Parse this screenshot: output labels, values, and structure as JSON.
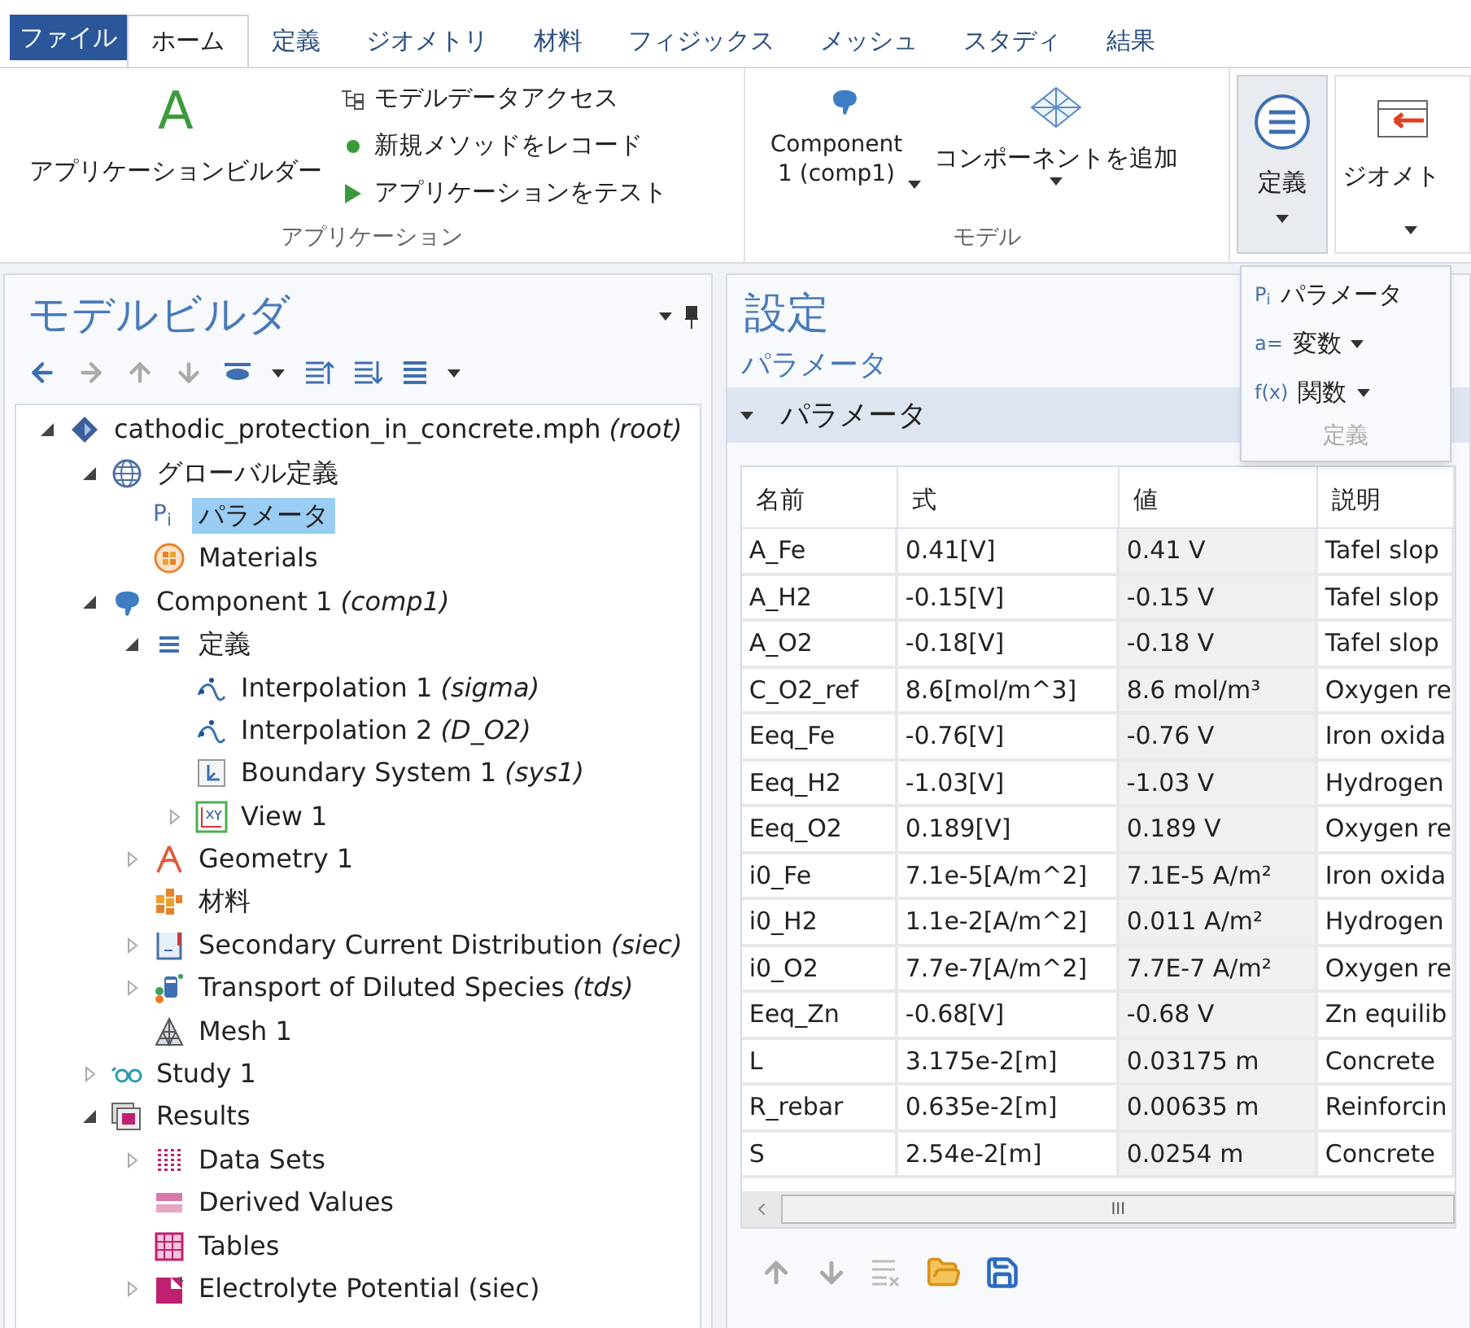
{
  "file_menu": {
    "label": "ファイル"
  },
  "tabs": [
    {
      "label": "ホーム",
      "selected": true
    },
    {
      "label": "定義",
      "selected": false
    },
    {
      "label": "ジオメトリ",
      "selected": false
    },
    {
      "label": "材料",
      "selected": false
    },
    {
      "label": "フィジックス",
      "selected": false
    },
    {
      "label": "メッシュ",
      "selected": false
    },
    {
      "label": "スタディ",
      "selected": false
    },
    {
      "label": "結果",
      "selected": false
    }
  ],
  "ribbon": {
    "application": {
      "label": "アプリケーション",
      "big_button": {
        "icon_text": "A",
        "label": "アプリケーションビルダー"
      },
      "small_buttons": [
        {
          "kind": "data-access",
          "label": "モデルデータアクセス"
        },
        {
          "kind": "record",
          "label": "新規メソッドをレコード"
        },
        {
          "kind": "test",
          "label": "アプリケーションをテスト"
        }
      ]
    },
    "model": {
      "label": "モデル",
      "component": "Component 1 (comp1)",
      "add_component": "コンポーネントを追加"
    },
    "definitions_button": {
      "label": "定義",
      "pressed": true
    },
    "geometry_button": {
      "label": "ジオメト",
      "pressed": false
    }
  },
  "definitions_menu": {
    "items": [
      {
        "icon_text": "P$_{i}$",
        "label": "パラメータ",
        "has_submenu": false
      },
      {
        "icon_text": "a=",
        "label": "変数",
        "has_submenu": true
      },
      {
        "icon_text": "f(x)",
        "label": "関数",
        "has_submenu": true
      }
    ],
    "footer": "定義"
  },
  "model_builder": {
    "title": "モデルビルダ",
    "tree": [
      {
        "kind": "file",
        "label": "cathodic_protection_in_concrete.mph *(root)*",
        "expandable": true,
        "expanded": true,
        "selected": false,
        "children": [
          {
            "kind": "globe",
            "label": "グローバル定義",
            "expandable": true,
            "expanded": true,
            "selected": false,
            "children": [
              {
                "kind": "parameters",
                "icon_text": "P$_{i}$",
                "label": "パラメータ",
                "expandable": false,
                "expanded": false,
                "selected": true
              },
              {
                "kind": "materials",
                "label": "Materials",
                "expandable": false,
                "expanded": false,
                "selected": false
              }
            ]
          },
          {
            "kind": "component",
            "label": "Component 1 *(comp1)*",
            "expandable": true,
            "expanded": true,
            "selected": false,
            "children": [
              {
                "kind": "definitions",
                "label": "定義",
                "expandable": true,
                "expanded": true,
                "selected": false,
                "children": [
                  {
                    "kind": "interpolation",
                    "label": "Interpolation 1 *(sigma)*",
                    "expandable": false,
                    "expanded": false,
                    "selected": false
                  },
                  {
                    "kind": "interpolation",
                    "label": "Interpolation 2 *(D_O2)*",
                    "expandable": false,
                    "expanded": false,
                    "selected": false
                  },
                  {
                    "kind": "boundary-system",
                    "label": "Boundary System 1 *(sys1)*",
                    "expandable": false,
                    "expanded": false,
                    "selected": false
                  },
                  {
                    "kind": "view",
                    "label": "View 1",
                    "expandable": true,
                    "expanded": false,
                    "selected": false
                  }
                ]
              },
              {
                "kind": "geometry",
                "label": "Geometry 1",
                "expandable": true,
                "expanded": false,
                "selected": false
              },
              {
                "kind": "material",
                "label": "材料",
                "expandable": false,
                "expanded": false,
                "selected": false
              },
              {
                "kind": "current",
                "label": "Secondary Current Distribution *(siec)*",
                "expandable": true,
                "expanded": false,
                "selected": false
              },
              {
                "kind": "transport",
                "label": "Transport of Diluted Species *(tds)*",
                "expandable": true,
                "expanded": false,
                "selected": false
              },
              {
                "kind": "mesh",
                "label": "Mesh 1",
                "expandable": false,
                "expanded": false,
                "selected": false
              }
            ]
          },
          {
            "kind": "study",
            "label": "Study 1",
            "expandable": true,
            "expanded": false,
            "selected": false
          },
          {
            "kind": "results",
            "label": "Results",
            "expandable": true,
            "expanded": true,
            "selected": false,
            "children": [
              {
                "kind": "datasets",
                "label": "Data Sets",
                "expandable": true,
                "expanded": false,
                "selected": false
              },
              {
                "kind": "derived",
                "label": "Derived Values",
                "expandable": false,
                "expanded": false,
                "selected": false
              },
              {
                "kind": "tables",
                "label": "Tables",
                "expandable": false,
                "expanded": false,
                "selected": false
              },
              {
                "kind": "plot",
                "label": "Electrolyte Potential (siec)",
                "expandable": true,
                "expanded": false,
                "selected": false
              }
            ]
          }
        ]
      }
    ]
  },
  "settings": {
    "title": "設定",
    "subtitle": "パラメータ",
    "section": "パラメータ",
    "table": {
      "columns": [
        "名前",
        "式",
        "値",
        "説明"
      ],
      "rows": [
        [
          "A_Fe",
          "0.41[V]",
          "0.41 V",
          "Tafel slop"
        ],
        [
          "A_H2",
          "-0.15[V]",
          "-0.15 V",
          "Tafel slop"
        ],
        [
          "A_O2",
          "-0.18[V]",
          "-0.18 V",
          "Tafel slop"
        ],
        [
          "C_O2_ref",
          "8.6[mol/m^3]",
          "8.6 mol/m³",
          "Oxygen re"
        ],
        [
          "Eeq_Fe",
          "-0.76[V]",
          "-0.76 V",
          "Iron oxida"
        ],
        [
          "Eeq_H2",
          "-1.03[V]",
          "-1.03 V",
          "Hydrogen"
        ],
        [
          "Eeq_O2",
          "0.189[V]",
          "0.189 V",
          "Oxygen re"
        ],
        [
          "i0_Fe",
          "7.1e-5[A/m^2]",
          "7.1E-5 A/m²",
          "Iron oxida"
        ],
        [
          "i0_H2",
          "1.1e-2[A/m^2]",
          "0.011 A/m²",
          "Hydrogen"
        ],
        [
          "i0_O2",
          "7.7e-7[A/m^2]",
          "7.7E-7 A/m²",
          "Oxygen re"
        ],
        [
          "Eeq_Zn",
          "-0.68[V]",
          "-0.68 V",
          "Zn equilib"
        ],
        [
          "L",
          "3.175e-2[m]",
          "0.03175 m",
          "Concrete"
        ],
        [
          "R_rebar",
          "0.635e-2[m]",
          "0.00635 m",
          "Reinforcin"
        ],
        [
          "S",
          "2.54e-2[m]",
          "0.0254 m",
          "Concrete"
        ]
      ]
    },
    "scrollbar_grip": "III"
  }
}
